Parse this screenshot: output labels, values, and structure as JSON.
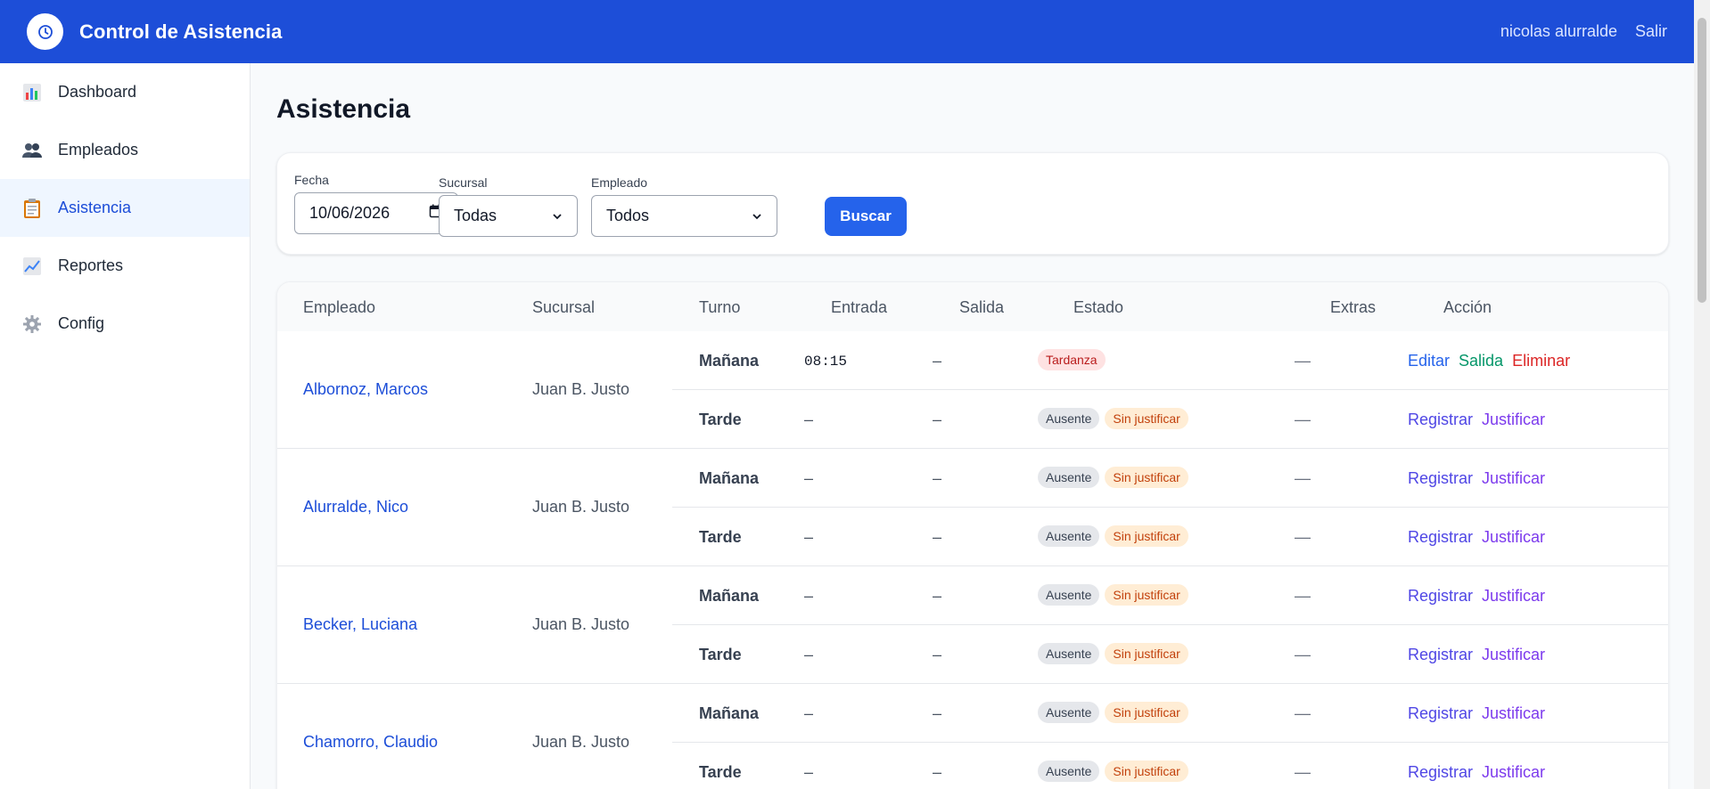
{
  "header": {
    "title": "Control de Asistencia",
    "user_name": "nicolas alurralde",
    "logout_label": "Salir"
  },
  "sidebar": {
    "items": [
      {
        "label": "Dashboard",
        "icon": "bar-chart-icon"
      },
      {
        "label": "Empleados",
        "icon": "users-icon"
      },
      {
        "label": "Asistencia",
        "icon": "clipboard-icon",
        "active": true
      },
      {
        "label": "Reportes",
        "icon": "line-chart-icon"
      },
      {
        "label": "Config",
        "icon": "gear-icon"
      }
    ]
  },
  "page": {
    "title": "Asistencia"
  },
  "filters": {
    "fecha_label": "Fecha",
    "fecha_value": "10/06/2026",
    "sucursal_label": "Sucursal",
    "sucursal_value": "Todas",
    "empleado_label": "Empleado",
    "empleado_value": "Todos",
    "search_button": "Buscar"
  },
  "table": {
    "headers": [
      "Empleado",
      "Sucursal",
      "Turno",
      "Entrada",
      "Salida",
      "Estado",
      "Extras",
      "Acción"
    ],
    "rows": [
      {
        "employee": "Albornoz, Marcos",
        "branch": "Juan B. Justo",
        "shifts": [
          {
            "turno": "Mañana",
            "entrada": "08:15",
            "salida": "–",
            "estado": [
              "Tardanza"
            ],
            "extras": "—",
            "acciones": [
              "Editar",
              "Salida",
              "Eliminar"
            ]
          },
          {
            "turno": "Tarde",
            "entrada": "–",
            "salida": "–",
            "estado": [
              "Ausente",
              "Sin justificar"
            ],
            "extras": "—",
            "acciones": [
              "Registrar",
              "Justificar"
            ]
          }
        ]
      },
      {
        "employee": "Alurralde, Nico",
        "branch": "Juan B. Justo",
        "shifts": [
          {
            "turno": "Mañana",
            "entrada": "–",
            "salida": "–",
            "estado": [
              "Ausente",
              "Sin justificar"
            ],
            "extras": "—",
            "acciones": [
              "Registrar",
              "Justificar"
            ]
          },
          {
            "turno": "Tarde",
            "entrada": "–",
            "salida": "–",
            "estado": [
              "Ausente",
              "Sin justificar"
            ],
            "extras": "—",
            "acciones": [
              "Registrar",
              "Justificar"
            ]
          }
        ]
      },
      {
        "employee": "Becker, Luciana",
        "branch": "Juan B. Justo",
        "shifts": [
          {
            "turno": "Mañana",
            "entrada": "–",
            "salida": "–",
            "estado": [
              "Ausente",
              "Sin justificar"
            ],
            "extras": "—",
            "acciones": [
              "Registrar",
              "Justificar"
            ]
          },
          {
            "turno": "Tarde",
            "entrada": "–",
            "salida": "–",
            "estado": [
              "Ausente",
              "Sin justificar"
            ],
            "extras": "—",
            "acciones": [
              "Registrar",
              "Justificar"
            ]
          }
        ]
      },
      {
        "employee": "Chamorro, Claudio",
        "branch": "Juan B. Justo",
        "shifts": [
          {
            "turno": "Mañana",
            "entrada": "–",
            "salida": "–",
            "estado": [
              "Ausente",
              "Sin justificar"
            ],
            "extras": "—",
            "acciones": [
              "Registrar",
              "Justificar"
            ]
          },
          {
            "turno": "Tarde",
            "entrada": "–",
            "salida": "–",
            "estado": [
              "Ausente",
              "Sin justificar"
            ],
            "extras": "—",
            "acciones": [
              "Registrar",
              "Justificar"
            ]
          }
        ]
      }
    ]
  },
  "colors": {
    "primary": "#1d4ed8",
    "button": "#2563eb",
    "tardanza": "#b91c1c",
    "sin_justificar": "#c2410c"
  }
}
